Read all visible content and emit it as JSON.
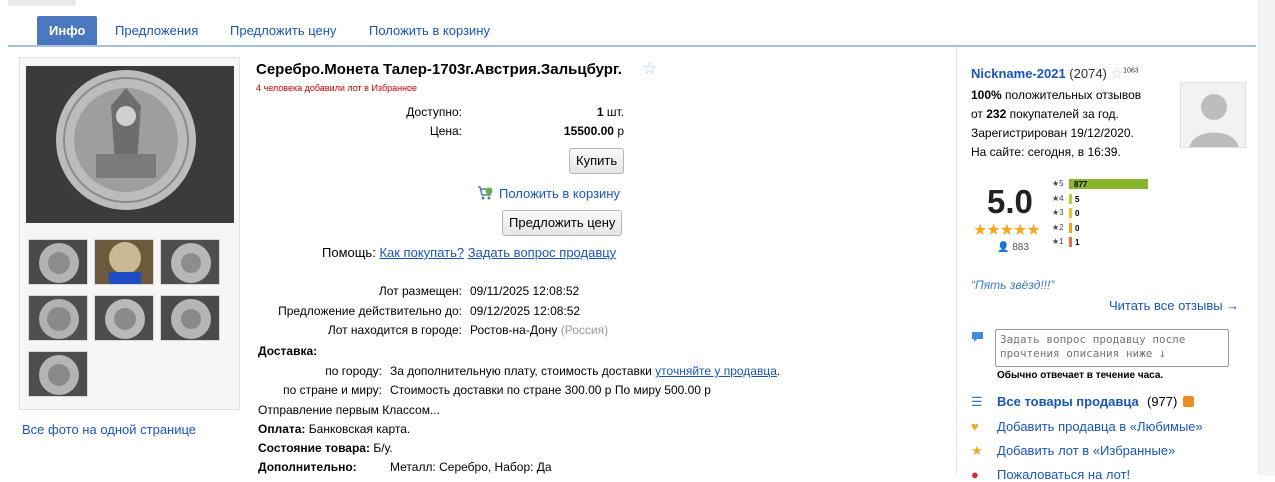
{
  "tabs": {
    "info": "Инфо",
    "offers": "Предложения",
    "propose_price": "Предложить цену",
    "add_to_cart": "Положить в корзину"
  },
  "gallery": {
    "all_photos_link": "Все фото на одной странице"
  },
  "lot": {
    "title": "Серебро.Монета Талер-1703г.Австрия.Зальцбург.",
    "favorites_note": "4 человека добавили лот в Избранное",
    "available_label": "Доступно:",
    "available_value": "1",
    "available_unit": "шт.",
    "price_label": "Цена:",
    "price_value": "15500.00",
    "price_currency": "р",
    "buy_button": "Купить",
    "add_to_cart_link": "Положить в корзину",
    "propose_price_button": "Предложить цену",
    "help_label": "Помощь:",
    "help_how_to_buy": "Как покупать?",
    "help_ask_seller": "Задать вопрос продавцу",
    "placed_label": "Лот размещен:",
    "placed_value": "09/11/2025 12:08:52",
    "valid_label": "Предложение действительно до:",
    "valid_value": "09/12/2025 12:08:52",
    "city_label": "Лот находится в городе:",
    "city_value": "Ростов-на-Дону",
    "country_value": "(Россия)",
    "delivery_heading": "Доставка:",
    "city_delivery_label": "по городу:",
    "city_delivery_text": "За дополнительную плату, стоимость доставки",
    "city_delivery_link": "уточняйте у продавца",
    "country_delivery_label": "по стране и миру:",
    "country_delivery_text": "Стоимость доставки по стране 300.00 р По миру 500.00 р",
    "shipping_note": "Отправление первым Классом...",
    "payment_label": "Оплата:",
    "payment_value": "Банковская карта.",
    "condition_label": "Состояние товара:",
    "condition_value": "Б/у.",
    "extra_label": "Дополнительно:",
    "extra_value": "Металл: Серебро, Набор: Да"
  },
  "seller": {
    "nickname": "Nickname-2021",
    "rating_count": "(2074)",
    "star_badge": "1063",
    "positive_percent": "100%",
    "positive_text": "положительных отзывов",
    "buyers_prefix": "от",
    "buyers_count": "232",
    "buyers_suffix": "покупателей за год.",
    "registered": "Зарегистрирован 19/12/2020.",
    "online": "На сайте: сегодня, в 16:39.",
    "score": "5.0",
    "stars": "★★★★★",
    "reviews_icon_count": "883",
    "rating_rows": [
      {
        "star": "★5",
        "count": "877",
        "fraction": 1.0,
        "color": "#8ab52f"
      },
      {
        "star": "★4",
        "count": "5",
        "fraction": 0.006,
        "color": "#b3d234"
      },
      {
        "star": "★3",
        "count": "0",
        "fraction": 0.0,
        "color": "#f0c428"
      },
      {
        "star": "★2",
        "count": "0",
        "fraction": 0.0,
        "color": "#f0a028"
      },
      {
        "star": "★1",
        "count": "1",
        "fraction": 0.001,
        "color": "#ee6b3a"
      }
    ],
    "quote": "“Пять звёзд!!!”",
    "read_all_reviews": "Читать все отзывы →",
    "ask_placeholder": "Задать вопрос продавцу после прочтения описания ниже ↓",
    "reply_note": "Обычно отвечает в течение часа.",
    "all_goods": "Все товары продавца",
    "all_goods_count": "(977)",
    "add_favorite_seller": "Добавить продавца в «Любимые»",
    "add_favorite_lot": "Добавить лот в «Избранные»",
    "report": "Пожаловаться на лот!"
  }
}
